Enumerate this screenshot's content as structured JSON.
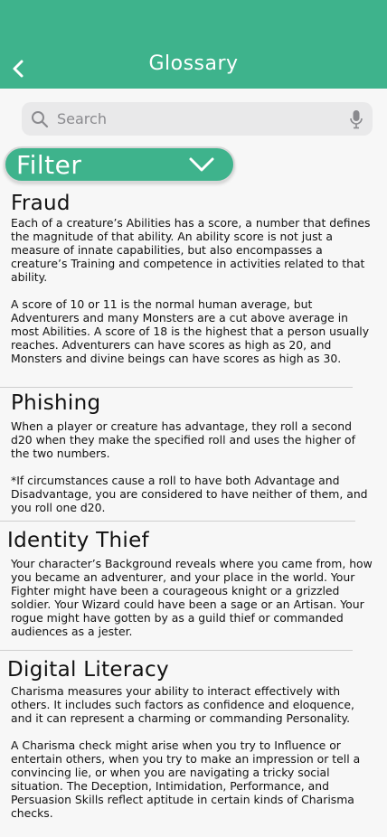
{
  "header": {
    "title": "Glossary"
  },
  "search": {
    "placeholder": "Search"
  },
  "filter": {
    "label": "Filter"
  },
  "entries": [
    {
      "title": "Fraud",
      "body": "Each of a creature’s Abilities has a score, a number that defines the magnitude of that ability. An ability score is not just a measure of innate capabilities, but also encompasses a creature’s Training and competence in activities related to that ability.\n\nA score of 10 or 11 is the normal human average, but Adventurers and many Monsters are a cut above average in most Abilities. A score of 18 is the highest that a person usually reaches. Adventurers can have scores as high as 20, and Monsters and divine beings can have scores as high as 30."
    },
    {
      "title": "Phishing",
      "body": "When a player or creature has advantage, they roll a second d20 when they make the specified roll and uses the higher of the two numbers.\n\n*If circumstances cause a roll to have both Advantage and Disadvantage, you are considered to have neither of them, and you roll one d20."
    },
    {
      "title": "Identity Thief",
      "body": "Your character’s Background reveals where you came from, how you became an adventurer, and your place in the world. Your Fighter might have been a courageous knight or a grizzled soldier. Your Wizard could have been a sage or an Artisan. Your rogue might have gotten by as a guild thief or commanded audiences as a jester."
    },
    {
      "title": "Digital Literacy",
      "body": "Charisma measures your ability to interact effectively with others. It includes such factors as confidence and eloquence, and it can represent a charming or commanding Personality.\n\nA Charisma check might arise when you try to Influence or entertain others, when you try to make an impression or tell a convincing lie, or when you are navigating a tricky social situation. The Deception, Intimidation, Performance, and Persuasion Skills reflect aptitude in certain kinds of Charisma checks."
    }
  ]
}
